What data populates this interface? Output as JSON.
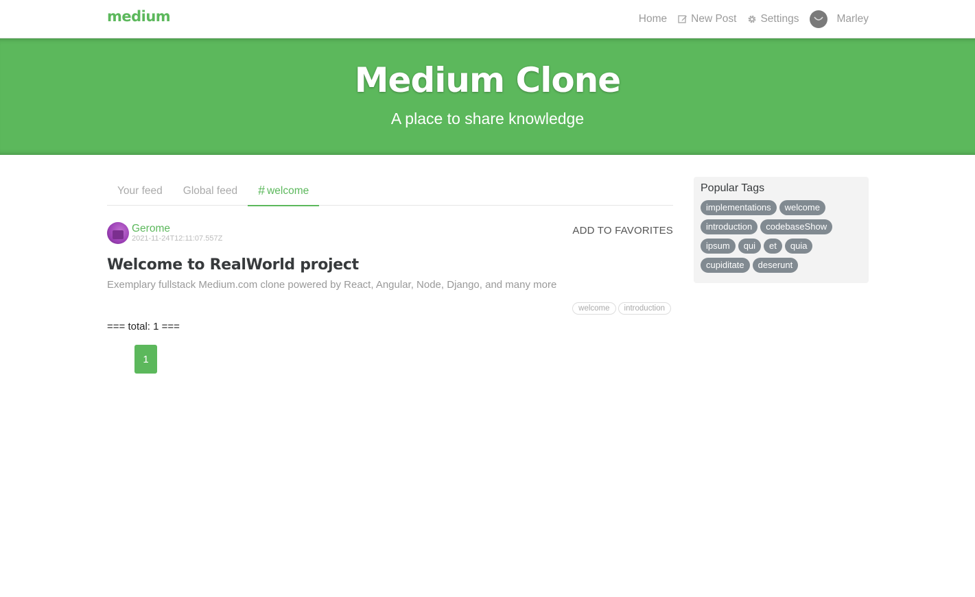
{
  "nav": {
    "brand": "medium",
    "home": "Home",
    "new_post": "New Post",
    "settings": "Settings",
    "username": "Marley"
  },
  "banner": {
    "title": "Medium Clone",
    "subtitle": "A place to share knowledge"
  },
  "feed": {
    "tabs": [
      {
        "label": "Your feed"
      },
      {
        "label": "Global feed"
      },
      {
        "label": "welcome",
        "prefix": "#"
      }
    ],
    "active_tab": 2
  },
  "article": {
    "author": "Gerome",
    "date": "2021-11-24T12:11:07.557Z",
    "favorite_label": "ADD TO FAVORITES",
    "title": "Welcome to RealWorld project",
    "description": "Exemplary fullstack Medium.com clone powered by React, Angular, Node, Django, and many more",
    "tags": [
      "welcome",
      "introduction"
    ]
  },
  "total_text": "=== total: 1 ===",
  "pagination": {
    "current": "1"
  },
  "sidebar": {
    "title": "Popular Tags",
    "tags": [
      "implementations",
      "welcome",
      "introduction",
      "codebaseShow",
      "ipsum",
      "qui",
      "et",
      "quia",
      "cupiditate",
      "deserunt"
    ]
  },
  "colors": {
    "accent": "#5cb85c",
    "tag_pill": "#818a91"
  }
}
